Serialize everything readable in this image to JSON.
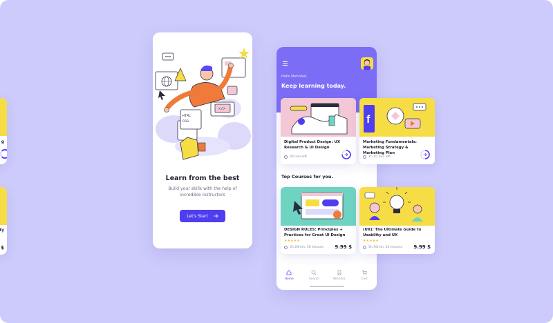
{
  "edge_cards": [
    {
      "title_fragment": "g"
    },
    {
      "title_fragment": "ity",
      "price_fragment": "$"
    }
  ],
  "onboarding": {
    "title": "Learn from the best",
    "subtitle": "Build your skills with the help of incredible instructors",
    "start_button": "Let's Start",
    "illustration": {
      "code_label_html": "HTML",
      "code_label_css": "CSS",
      "code_label_box": "</>"
    }
  },
  "home": {
    "greeting": "Hello Mehrdad,",
    "headline": "Keep learning today.",
    "top_courses_title": "Top Courses for you.",
    "continue_courses": [
      {
        "title": "Digital Product Design: UX Research & UI Design",
        "duration": "30 min left",
        "progress": 0.75
      },
      {
        "title": "Marketing Fundamentals: Marketing Strategy & Marketing Plan",
        "duration": "1h 10 min left",
        "progress": 0.5
      }
    ],
    "top_courses": [
      {
        "title": "DESIGN RULES: Principles + Practices for Great UI Design",
        "stars": "★★★★★",
        "duration": "3h 20min, 30 lessons",
        "price": "9.99 $"
      },
      {
        "title": "(UX): The Ultimate Guide to Usability and UX",
        "stars": "★★★★★",
        "duration": "5h 30min, 22 lessons",
        "price": "9.99 $"
      }
    ],
    "nav": [
      {
        "label": "Home",
        "icon": "home-icon",
        "active": true
      },
      {
        "label": "Search",
        "icon": "search-icon",
        "active": false
      },
      {
        "label": "Wishlist",
        "icon": "bookmark-icon",
        "active": false
      },
      {
        "label": "Cart",
        "icon": "cart-icon",
        "active": false
      }
    ]
  },
  "colors": {
    "background": "#cdcbfb",
    "primary": "#4f3df0",
    "hero": "#7b6df5",
    "yellow": "#f6dd45",
    "pink": "#f3c7d5",
    "teal": "#6fd3c2",
    "orange": "#f07a3a"
  }
}
